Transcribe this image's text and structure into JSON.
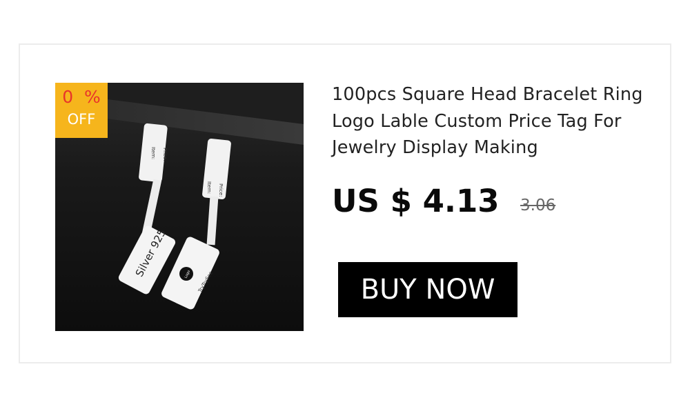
{
  "colors": {
    "badge_background": "#f6b51c",
    "badge_percent": "#e8352a",
    "button_background": "#000000",
    "button_text": "#ffffff"
  },
  "badge": {
    "top": "0  %",
    "bottom": "OFF"
  },
  "product": {
    "title": "100pcs Square Head Bracelet Ring Logo Lable Custom Price Tag For Jewelry Display Making",
    "price": "US $ 4.13",
    "original_price": "3.06",
    "tag_left": {
      "item_label": "Item:",
      "price_label": "Price:",
      "bottom_text": "Silver 925"
    },
    "tag_right": {
      "item_label": "Item:",
      "price_label": "Price:",
      "logo_text": "Logo",
      "brand_text": "TryTrySee"
    }
  },
  "buttons": {
    "buy_now": "BUY NOW"
  }
}
